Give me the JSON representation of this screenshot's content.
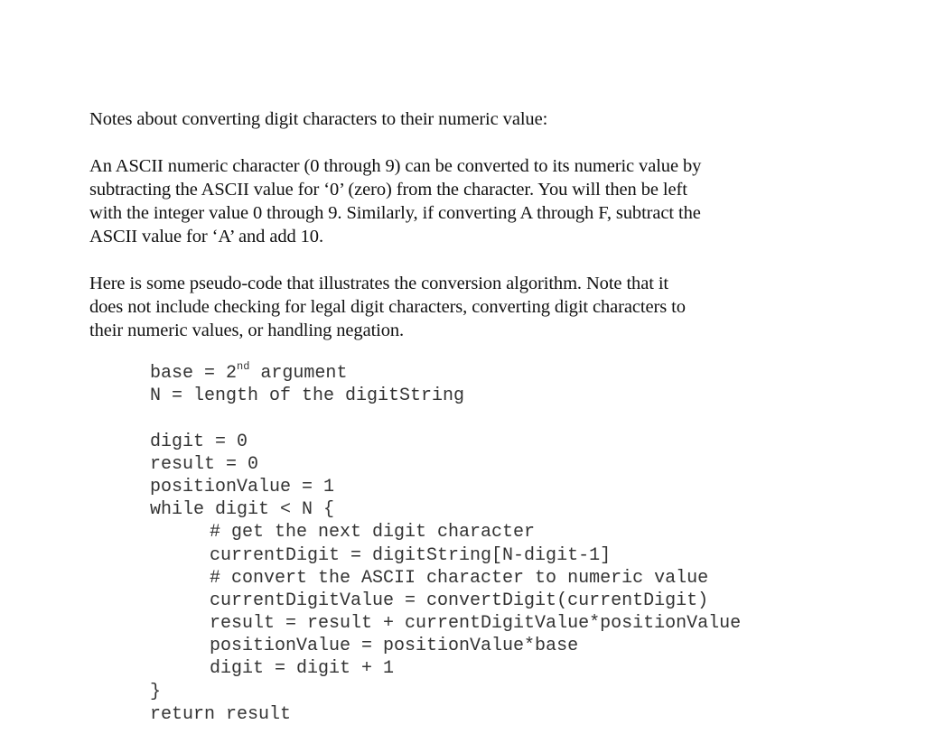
{
  "document": {
    "heading": "Notes about converting digit characters to their numeric value:",
    "paragraph1_lines": [
      "An ASCII numeric character (0 through 9) can be converted to its numeric value by",
      "subtracting the ASCII value for ‘0’ (zero) from the character.  You will then be left",
      "with the integer value 0 through 9.  Similarly, if converting A through F, subtract the",
      "ASCII value for ‘A’ and add 10."
    ],
    "paragraph2_lines": [
      "Here is some pseudo-code that illustrates the conversion algorithm.  Note that it",
      "does not include checking for legal digit characters, converting digit characters to",
      "their numeric values, or handling negation."
    ],
    "code": {
      "line_base_prefix": "base = 2",
      "line_base_sup": "nd",
      "line_base_suffix": " argument",
      "line_n": "N = length of the digitString",
      "line_digit": "digit = 0",
      "line_result": "result = 0",
      "line_position": "positionValue = 1",
      "line_while": "while digit < N {",
      "loop_body": [
        "# get the next digit character",
        "currentDigit = digitString[N-digit-1]",
        "# convert the ASCII character to numeric value",
        "currentDigitValue = convertDigit(currentDigit)",
        "result = result + currentDigitValue*positionValue",
        "positionValue = positionValue*base",
        "digit = digit + 1"
      ],
      "line_close": "}",
      "line_return": "return result"
    }
  }
}
